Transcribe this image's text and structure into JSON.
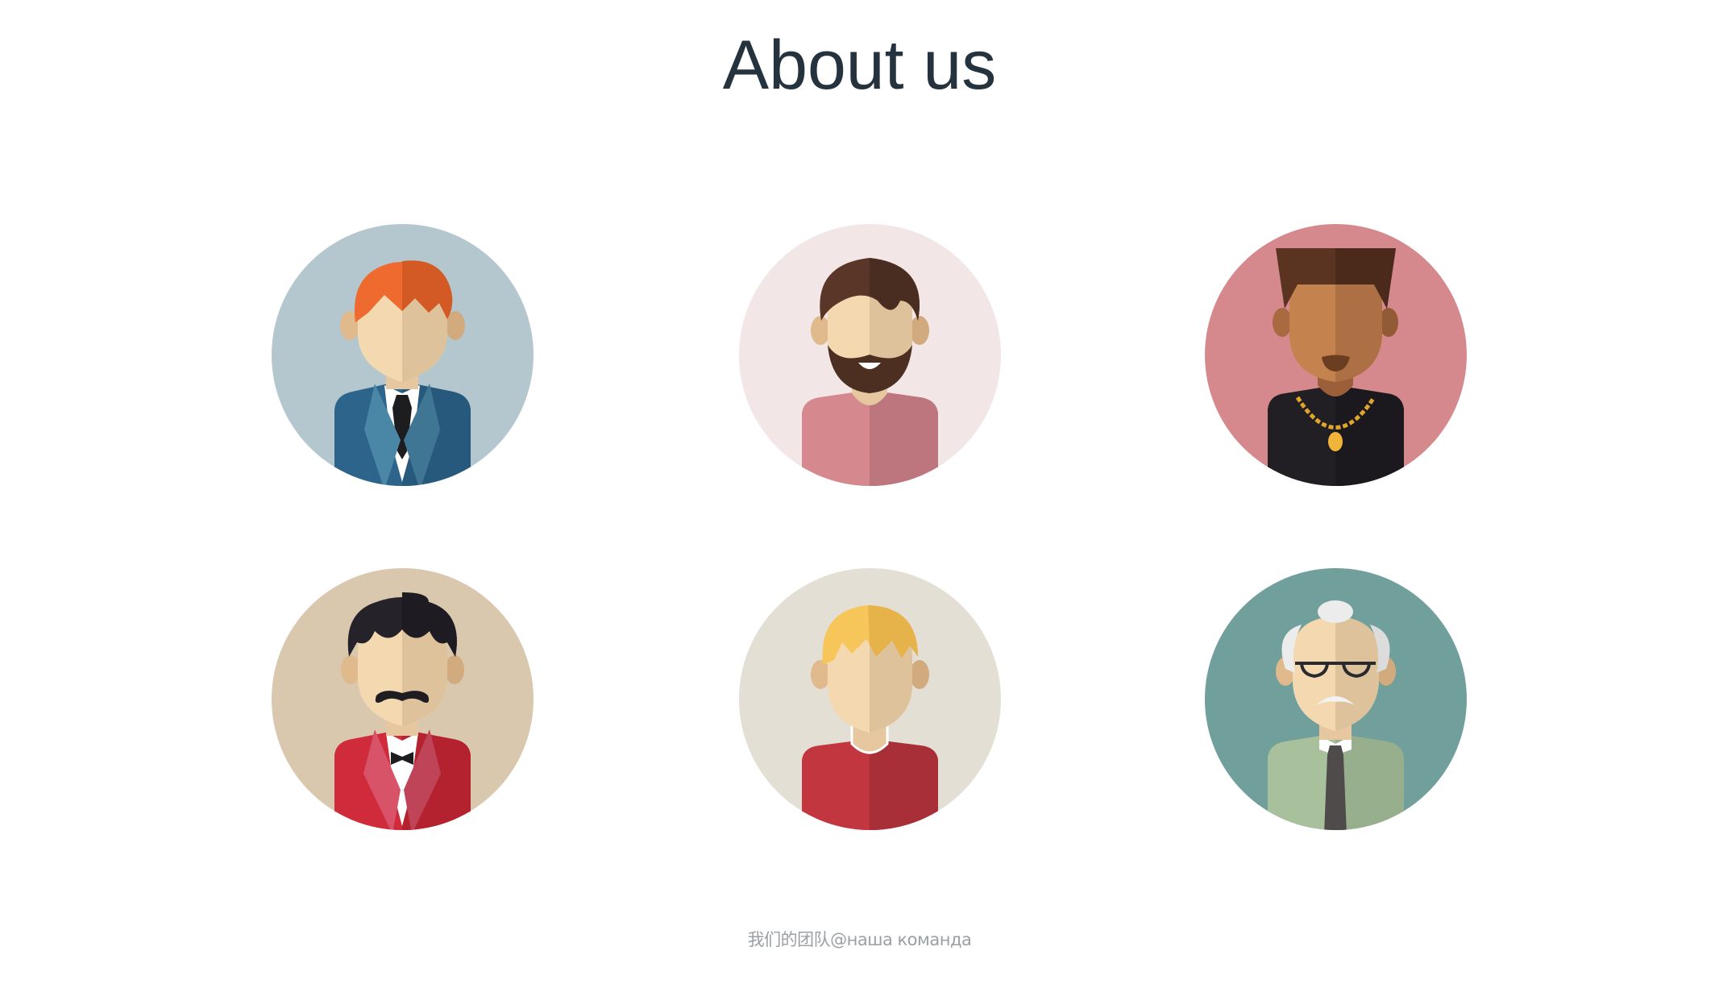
{
  "page": {
    "title": "About us",
    "footer": "我们的团队@наша команда"
  },
  "members": [
    {
      "name": "redhead-businessman",
      "bg": "#b4c7ce"
    },
    {
      "name": "bearded-man",
      "bg": "#f2e6e6"
    },
    {
      "name": "man-with-gold-chain",
      "bg": "#d6898c"
    },
    {
      "name": "mustached-man-bowtie",
      "bg": "#d9c8ae"
    },
    {
      "name": "blond-man",
      "bg": "#e3dfd5"
    },
    {
      "name": "old-man-glasses",
      "bg": "#709f9c"
    }
  ]
}
